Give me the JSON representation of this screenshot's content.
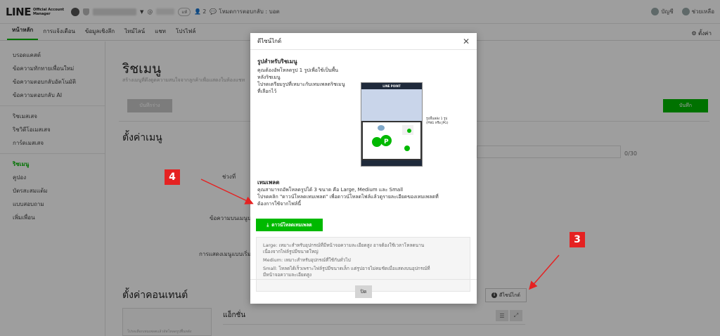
{
  "topbar": {
    "logo_main": "LINE",
    "logo_sub1": "Official Account",
    "logo_sub2": "Manager",
    "account_id_prefix": "@",
    "verified_badge": "แท้",
    "friends_count": "2",
    "reply_mode": "โหมดการตอบกลับ : บอต",
    "account_label": "บัญชี",
    "help_label": "ช่วยเหลือ"
  },
  "nav": {
    "tabs": [
      "หน้าหลัก",
      "การแจ้งเตือน",
      "ข้อมูลเชิงลึก",
      "ไทม์ไลน์",
      "แชท",
      "โปรไฟล์"
    ],
    "settings_label": "ตั้งค่า"
  },
  "sidebar": {
    "items": [
      "บรอดแคสต์",
      "ข้อความทักทายเพื่อนใหม่",
      "ข้อความตอบกลับอัตโนมัติ",
      "ข้อความตอบกลับ AI",
      "ริชเมสเสจ",
      "ริชวิดีโอเมสเสจ",
      "การ์ดเมสเสจ",
      "ริชเมนู",
      "คูปอง",
      "บัตรสะสมแต้ม",
      "แบบสอบถาม",
      "เพิ่มเพื่อน"
    ]
  },
  "main": {
    "page_title": "ริชเมนู",
    "page_desc": "สร้างเมนูที่ดึงดูดความสนใจจากลูกค้าเพื่อแสดงในห้องแชท",
    "save_draft_label": "บันทึกร่าง",
    "save_label": "บันทึก",
    "menu_settings_title": "ตั้งค่าเมนู",
    "char_count": "0/30",
    "label_period": "ช่วงที่",
    "label_menu_bar_text": "ข้อความบนเมนูบา",
    "label_default_display": "การแสดงเมนูแบบเริ่มต้",
    "content_settings_title": "ตั้งค่าคอนเทนต์",
    "design_button_label": "ดีไซน์ไกด์",
    "thumb_hint": "โปรดเลือกเทมเพลตแล้วอัพโหลดรูปพื้นหลัง",
    "action_label": "แอ็กชั่น"
  },
  "modal": {
    "title": "ดีไซน์ไกด์",
    "image_heading": "รูปสำหรับริชเมนู",
    "image_text": [
      "คุณต้องอัพโหลดรูป 1 รูปเพื่อใช้เป็นพื้น",
      "หลังริชเมนู",
      "โปรดเตรียมรูปที่เหมาะกับเทมเพลตริชเมนู",
      "ที่เลือกไว้"
    ],
    "preview_header": "LINE POINT",
    "preview_note_1": "รูปพื้นหลัง 1 รูป",
    "preview_note_2": "(PNG หรือ JPG)",
    "template_heading": "เทมเพลต",
    "template_text": [
      "คุณสามารถอัพโหลดรูปได้ 3 ขนาด คือ Large, Medium และ Small",
      "โปรดคลิก \"ดาวน์โหลดเทมเพลต\" เพื่อดาวน์โหลดไฟล์แล้วดูรายละเอียดของเทมเพลตที่",
      "ต้องการใช้จากไฟล์นี้"
    ],
    "download_label": "ดาวน์โหลดเทมเพลต",
    "info": {
      "large_1": "Large: เหมาะสำหรับอุปกรณ์ที่มีหน้าจอความละเอียดสูง อาจต้องใช้เวลาโหลดนาน",
      "large_2": "เนื่องจากไฟล์รูปมีขนาดใหญ่",
      "medium": "Medium: เหมาะสำหรับอุปกรณ์ที่ใช้กันทั่วไป",
      "small_1": "Small: โหลดได้เร็วเพราะไฟล์รูปมีขนาดเล็ก แต่รูปอาจไม่คมชัดเมื่อแสดงบนอุปกรณ์ที่",
      "small_2": "มีหน้าจอความละเอียดสูง"
    },
    "close_label": "ปิด"
  },
  "annotations": {
    "badge_left": "4",
    "badge_right": "3",
    "color": "#e52222"
  },
  "colors": {
    "accent": "#00b900"
  }
}
